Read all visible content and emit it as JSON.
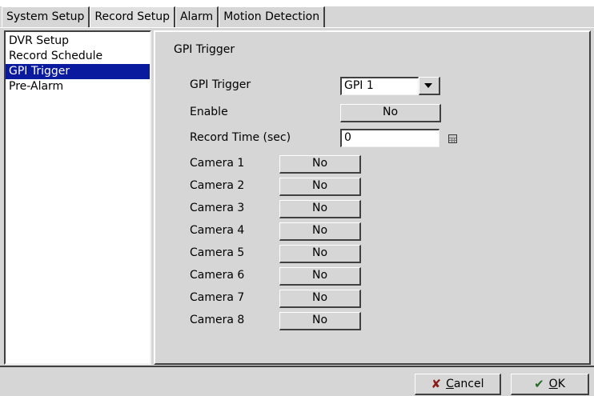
{
  "tabs": [
    "System Setup",
    "Record Setup",
    "Alarm",
    "Motion Detection"
  ],
  "active_tab": "Record Setup",
  "left_list": [
    "DVR Setup",
    "Record Schedule",
    "GPI Trigger",
    "Pre-Alarm"
  ],
  "selected_item": "GPI Trigger",
  "panel": {
    "title": "GPI Trigger",
    "gpi_trigger_label": "GPI Trigger",
    "gpi_trigger_value": "GPI 1",
    "enable_label": "Enable",
    "enable_value": "No",
    "record_time_label": "Record Time (sec)",
    "record_time_value": "0",
    "cameras": [
      {
        "label": "Camera 1",
        "value": "No"
      },
      {
        "label": "Camera 2",
        "value": "No"
      },
      {
        "label": "Camera 3",
        "value": "No"
      },
      {
        "label": "Camera 4",
        "value": "No"
      },
      {
        "label": "Camera 5",
        "value": "No"
      },
      {
        "label": "Camera 6",
        "value": "No"
      },
      {
        "label": "Camera 7",
        "value": "No"
      },
      {
        "label": "Camera 8",
        "value": "No"
      }
    ]
  },
  "buttons": {
    "cancel_mnemonic": "C",
    "cancel_rest": "ancel",
    "ok_mnemonic": "O",
    "ok_rest": "K"
  },
  "icons": {
    "cancel": "x-icon",
    "ok": "check-icon",
    "dropdown": "chevron-down-icon",
    "keypad": "calculator-icon"
  },
  "colors": {
    "selection": "#0a1a9e",
    "background": "#d6d6d6"
  }
}
